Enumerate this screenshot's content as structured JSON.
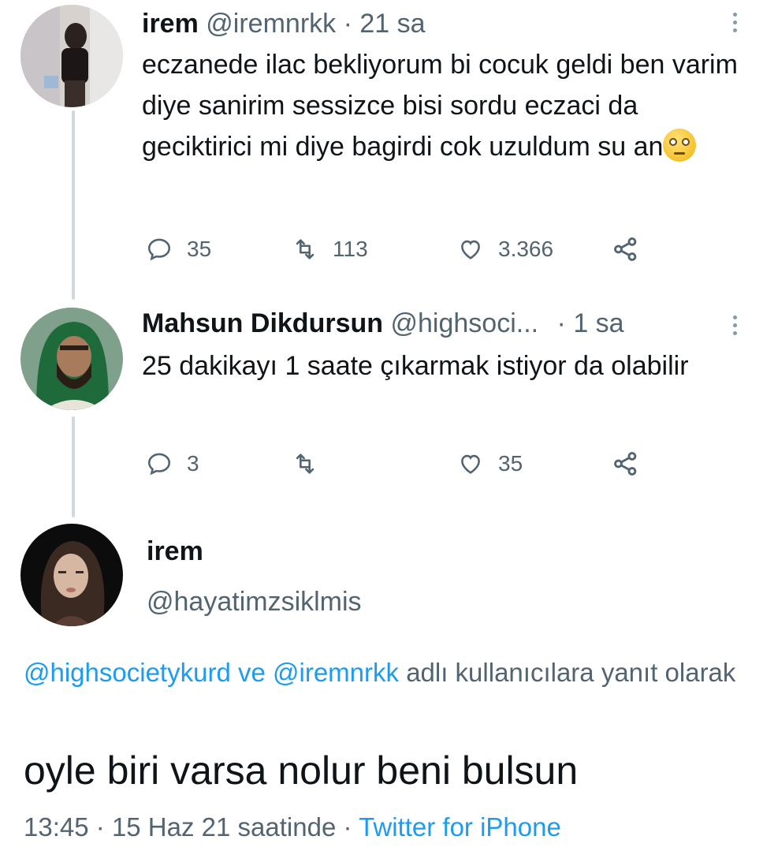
{
  "tweet1": {
    "name": "irem",
    "handle": "@iremnrkk",
    "separator": "·",
    "time": "21 sa",
    "text": "eczanede ilac bekliyorum bi cocuk geldi ben varim diye sanirim sessizce bisi sordu eczaci da geciktirici mi diye bagirdi cok uzuldum su an",
    "emoji": "face-with-rolling-eyes",
    "replies": "35",
    "retweets": "113",
    "likes": "3.366"
  },
  "tweet2": {
    "name": "Mahsun Dikdursun",
    "handle": "@highsoci...",
    "separator": "·",
    "time": "1 sa",
    "text": "25 dakikayı 1 saate çıkarmak istiyor da olabilir",
    "replies": "3",
    "retweets": "",
    "likes": "35"
  },
  "main_tweet": {
    "name": "irem",
    "handle": "@hayatimzsiklmis",
    "reply_mention_1": "@highsocietykurd",
    "reply_connector": "ve",
    "reply_mention_2": "@iremnrkk",
    "reply_suffix": "adlı kullanıcılara yanıt olarak",
    "text": "oyle biri varsa nolur beni bulsun",
    "time": "13:45",
    "separator_1": "·",
    "date": "15 Haz 21 saatinde",
    "separator_2": "·",
    "source": "Twitter for iPhone"
  },
  "colors": {
    "link": "#1d9bf0",
    "muted": "#536471",
    "thread_line": "#cfd9de"
  }
}
